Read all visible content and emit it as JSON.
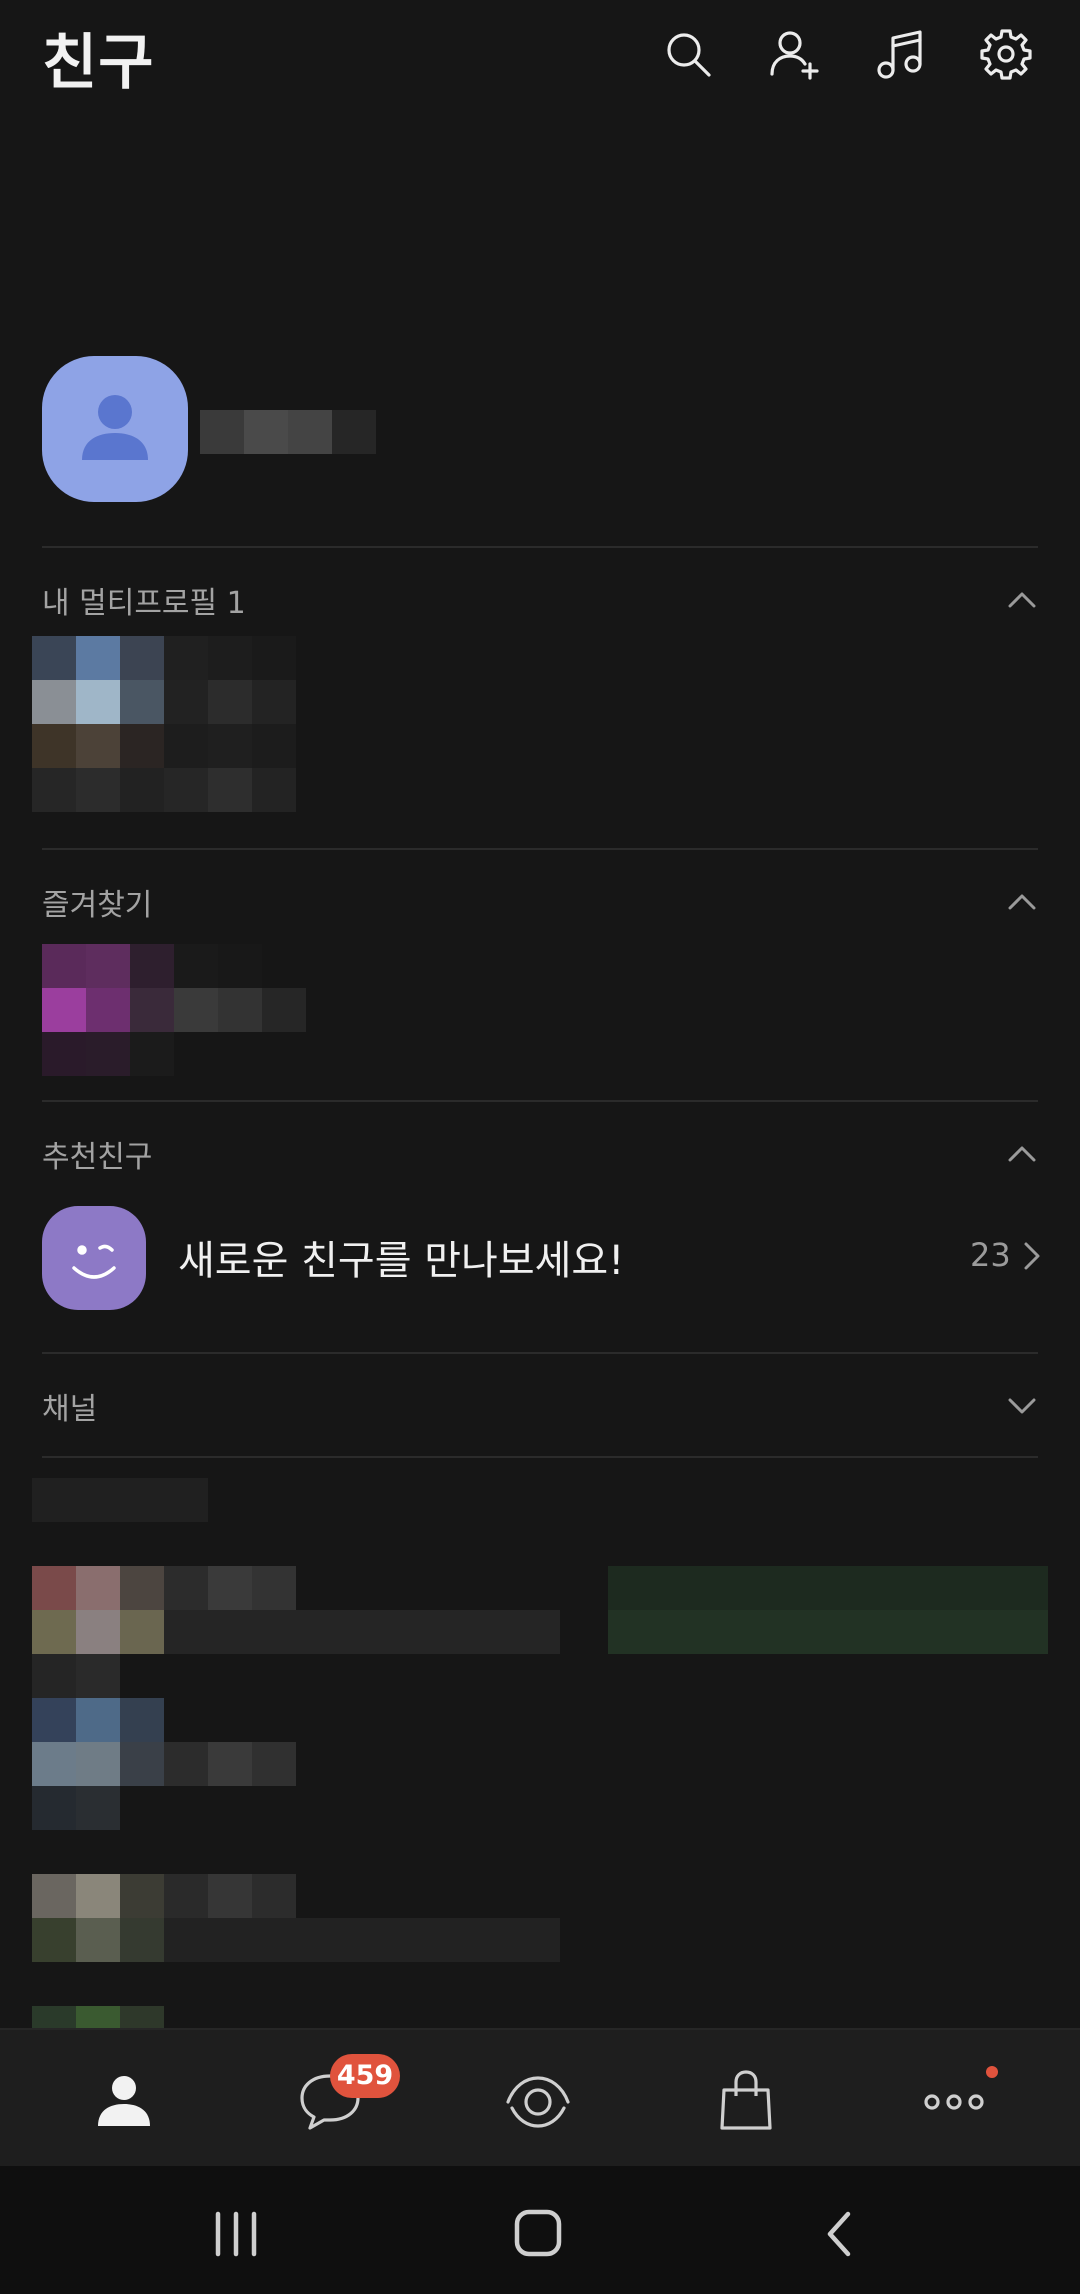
{
  "header": {
    "title": "친구",
    "icons": [
      "search-icon",
      "add-friend-icon",
      "music-icon",
      "settings-icon"
    ]
  },
  "sections": {
    "multi_profile": {
      "label": "내 멀티프로필 1"
    },
    "favorites": {
      "label": "즐겨찾기"
    },
    "recommended": {
      "label": "추천친구",
      "promo_text": "새로운 친구를 만나보세요!",
      "count": "23"
    },
    "channel": {
      "label": "채널"
    }
  },
  "bottom_nav": {
    "items": [
      "friends-icon",
      "chat-icon",
      "view-icon",
      "shopping-icon",
      "more-icon"
    ],
    "chat_badge": "459"
  },
  "colors": {
    "background": "#161616",
    "avatar": "#8ea3e6",
    "recommend_icon": "#8d79c6",
    "badge": "#e0533d"
  }
}
